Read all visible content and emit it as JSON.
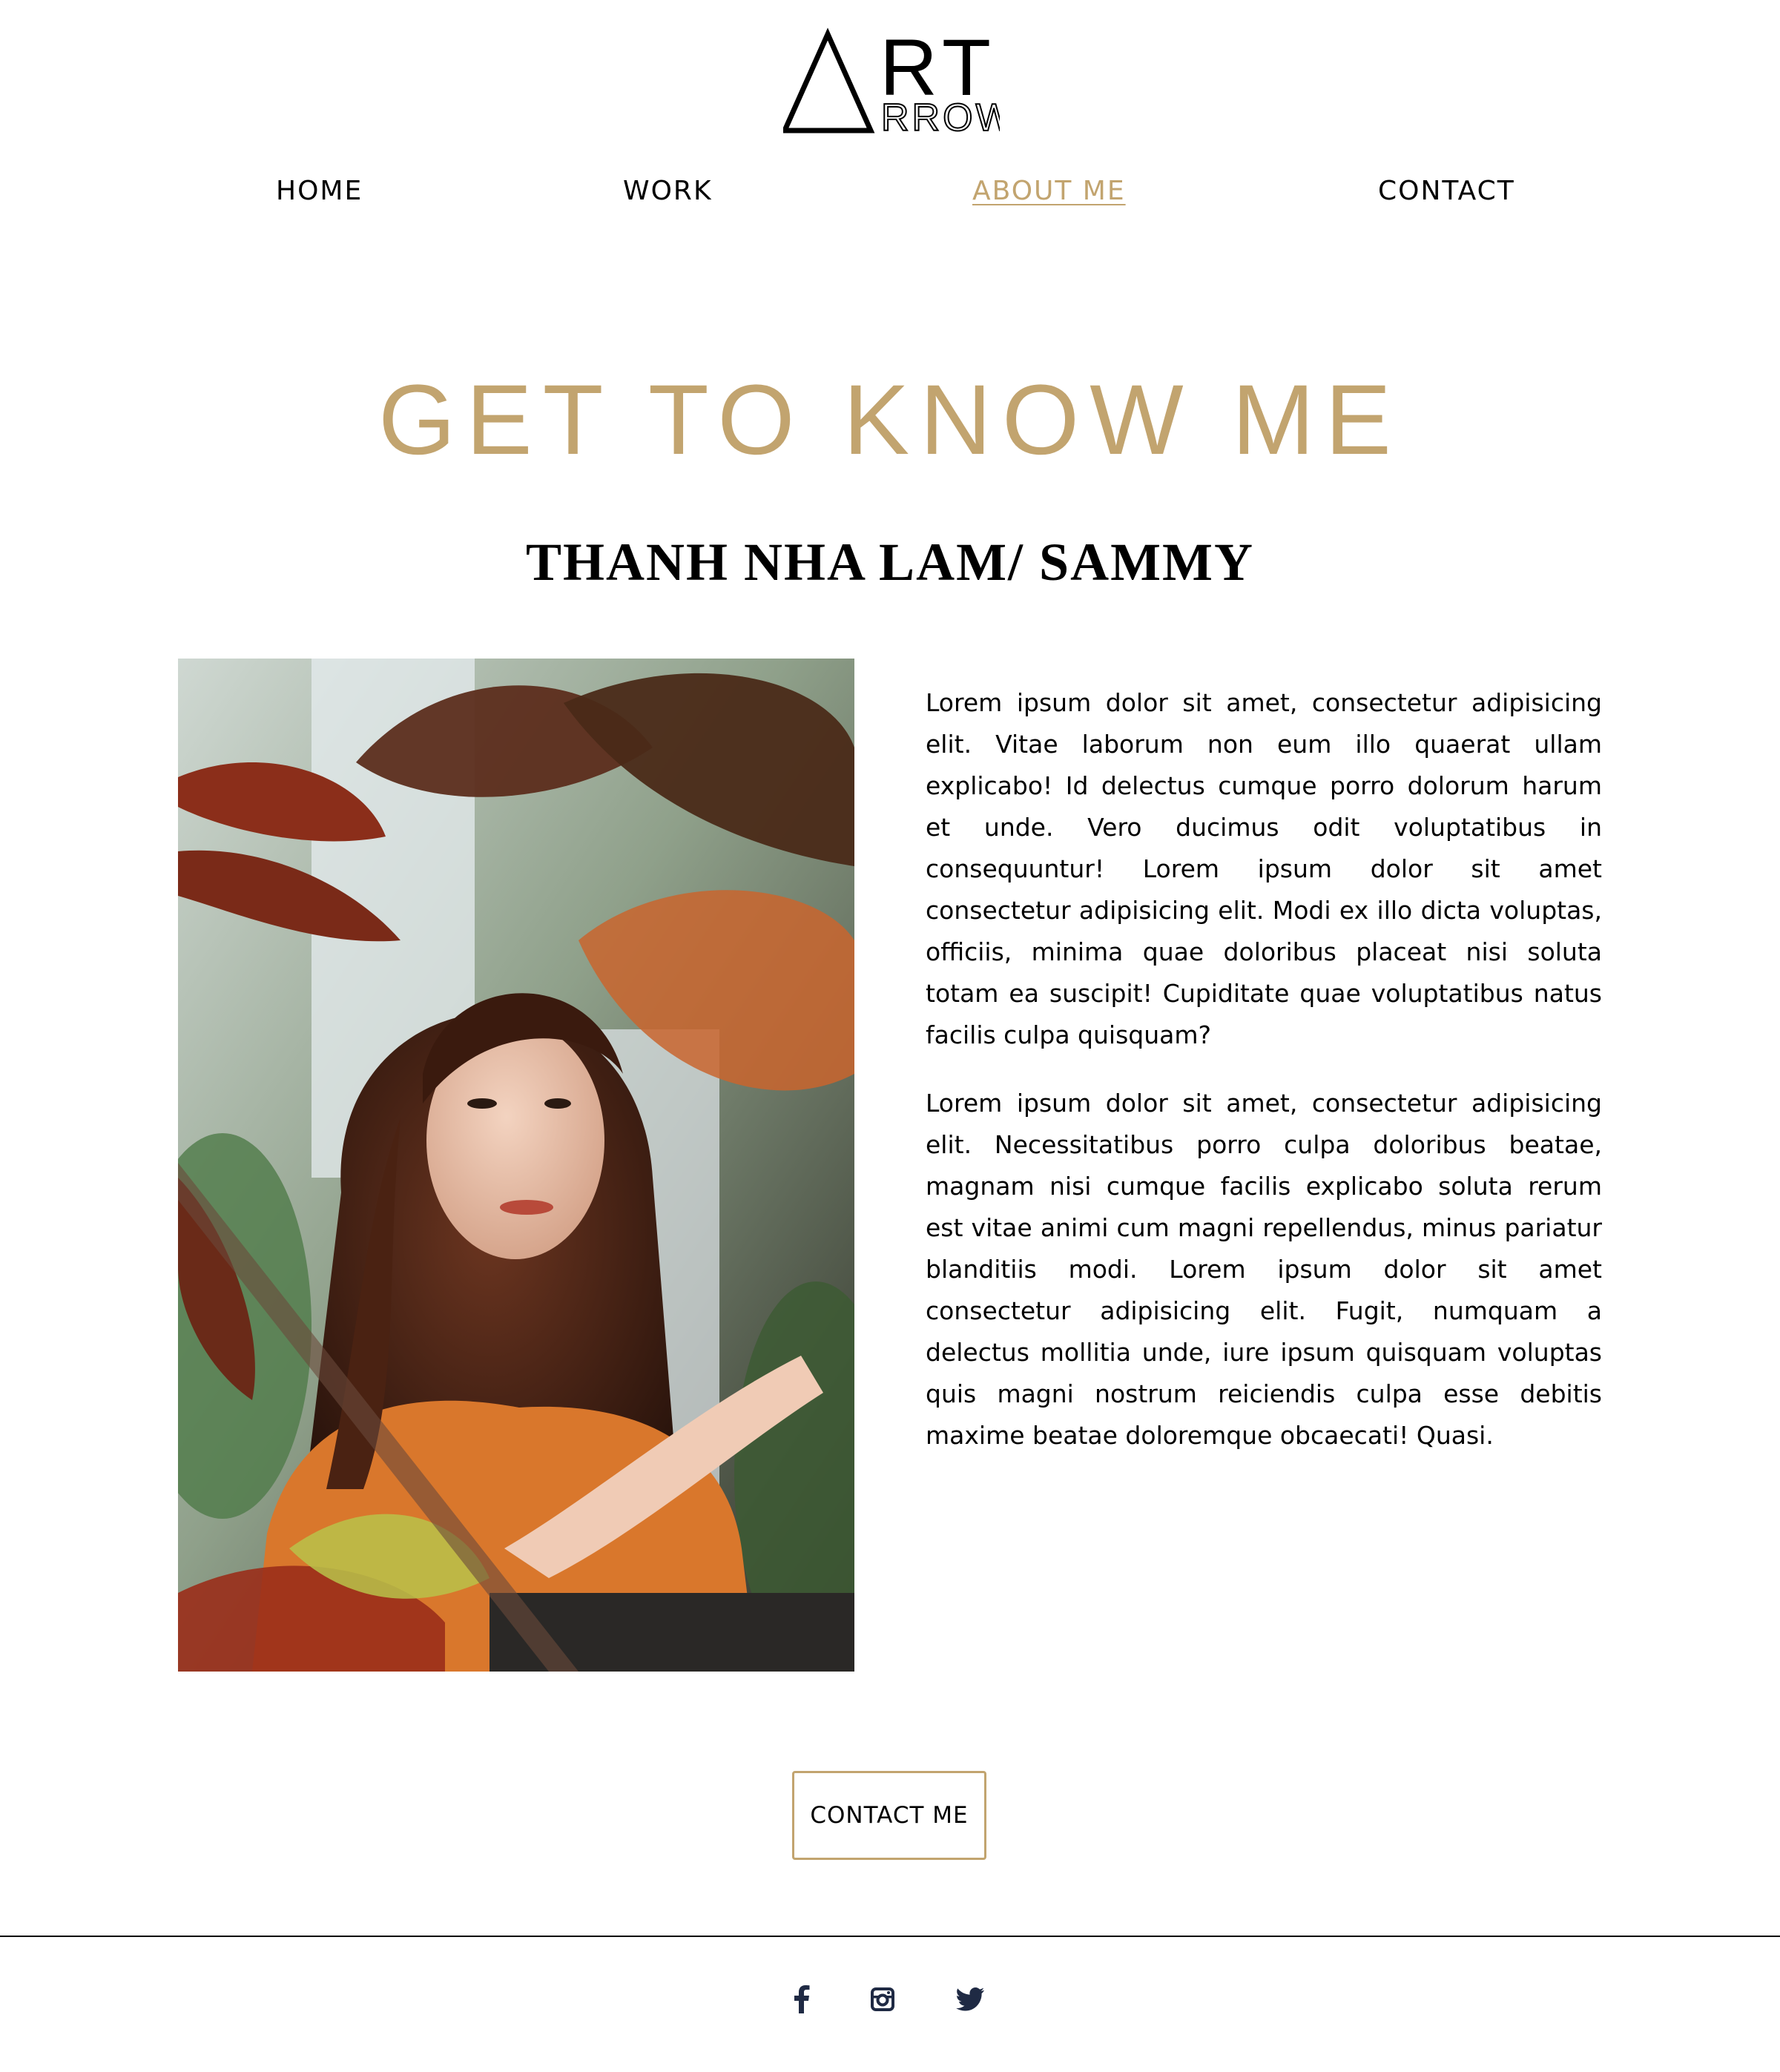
{
  "brand": {
    "logo_text_top": "RT",
    "logo_text_bottom": "RROW"
  },
  "nav": {
    "items": [
      {
        "label": "HOME",
        "active": false
      },
      {
        "label": "WORK",
        "active": false
      },
      {
        "label": "ABOUT ME",
        "active": true
      },
      {
        "label": "CONTACT",
        "active": false
      }
    ]
  },
  "hero": {
    "headline": "GET TO KNOW ME",
    "name": "THANH NHA LAM/ SAMMY"
  },
  "bio": {
    "paragraphs": [
      "Lorem ipsum dolor sit amet, consectetur adipisicing elit. Vitae laborum non eum illo quaerat ullam explicabo! Id delectus cumque porro dolorum harum et unde. Vero ducimus odit voluptatibus in consequuntur! Lorem ipsum dolor sit amet consectetur adipisicing elit. Modi ex illo dicta voluptas, officiis, minima quae doloribus placeat nisi soluta totam ea suscipit! Cupiditate quae voluptatibus natus facilis culpa quisquam?",
      "Lorem ipsum dolor sit amet, consectetur adipisicing elit. Necessitatibus porro culpa doloribus beatae, magnam nisi cumque facilis explicabo soluta rerum est vitae animi cum magni repellendus, minus pariatur blanditiis modi. Lorem ipsum dolor sit amet consectetur adipisicing elit. Fugit, numquam a delectus mollitia unde, iure ipsum quisquam voluptas quis magni nostrum reiciendis culpa esse debitis maxime beatae doloremque obcaecati! Quasi."
    ]
  },
  "cta": {
    "label": "CONTACT ME"
  },
  "footer": {
    "social": [
      {
        "icon": "facebook-icon"
      },
      {
        "icon": "instagram-icon"
      },
      {
        "icon": "twitter-icon"
      }
    ]
  },
  "colors": {
    "accent_gold": "#c2a46f",
    "text": "#000000",
    "social_icon": "#1f2a44"
  }
}
